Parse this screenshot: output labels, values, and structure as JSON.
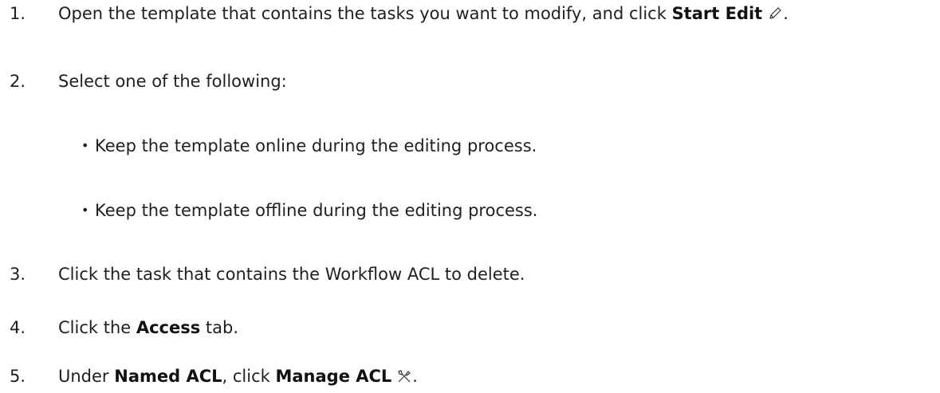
{
  "steps": [
    {
      "number": "1.",
      "pre": "Open the template that contains the tasks you want to modify, and click ",
      "bold": "Start Edit",
      "icon": "pencil-icon",
      "post": "."
    },
    {
      "number": "2.",
      "text": "Select one of the following:",
      "options": [
        "Keep the template online during the editing process.",
        "Keep the template offline during the editing process."
      ]
    },
    {
      "number": "3.",
      "text": "Click the task that contains the Workflow ACL to delete."
    },
    {
      "number": "4.",
      "pre": "Click the ",
      "bold": "Access",
      "post": " tab."
    },
    {
      "number": "5.",
      "pre": "Under ",
      "bold": "Named ACL",
      "mid": ", click ",
      "bold2": "Manage ACL",
      "icon": "tools-icon",
      "post": "."
    }
  ],
  "bullet_char": "•"
}
